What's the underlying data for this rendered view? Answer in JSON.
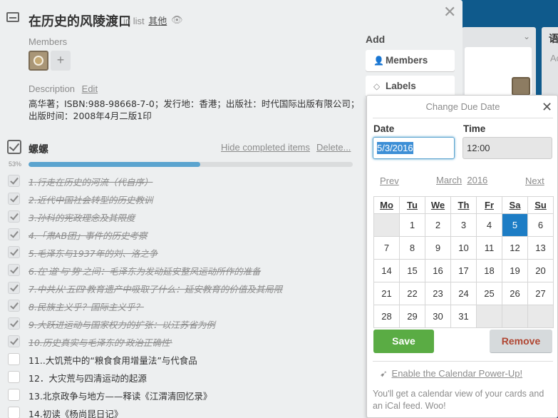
{
  "background": {
    "list_title_partial": "语",
    "list_card_partial": "Ac"
  },
  "card": {
    "title": "在历史的风陵渡口",
    "in_list_prefix": "in list",
    "list_name": "其他",
    "members_label": "Members",
    "add_member_symbol": "+",
    "description_label": "Description",
    "description_edit": "Edit",
    "description_text": "高华著；ISBN:988-98668-7-0；发行地：香港；出版社：时代国际出版有限公司；出版时间：2008年4月二版1印"
  },
  "checklist": {
    "title": "螺螺",
    "hide_completed": "Hide completed items",
    "delete": "Delete...",
    "percent_label": "53%",
    "progress_fraction": 0.53,
    "items": [
      {
        "text": "1.行走在历史的河流（代自序）",
        "done": true
      },
      {
        "text": "2.近代中国社会转型的历史教训",
        "done": true
      },
      {
        "text": "3.孙科的宪政理念及其限度",
        "done": true
      },
      {
        "text": "4.「肃AB团」事件的历史考察",
        "done": true
      },
      {
        "text": "5.毛泽东与1937年的刘、洛之争",
        "done": true
      },
      {
        "text": "6.在'道'与'势'之间：毛泽东为发动延安整风运动所作的准备",
        "done": true
      },
      {
        "text": "7.中共从'五四'教育遗产中吸取了什么：延安教育的价值及其局限",
        "done": true
      },
      {
        "text": "8.民族主义乎？国际主义乎？",
        "done": true
      },
      {
        "text": "9.大跃进运动与国家权力的扩张：以江苏省为例",
        "done": true
      },
      {
        "text": "10.历史真实与毛泽东的'政治正确性'",
        "done": true
      },
      {
        "text": "11..大饥荒中的“粮食食用增量法”与代食品",
        "done": false
      },
      {
        "text": "12．大灾荒与四清运动的起源",
        "done": false
      },
      {
        "text": "13.北京政争与地方——释读《江渭清回忆录》",
        "done": false
      },
      {
        "text": "14.初读《杨尚昆日记》",
        "done": false
      }
    ]
  },
  "sidebar": {
    "add_label": "Add",
    "buttons": [
      {
        "label": "Members",
        "icon": "person-icon"
      },
      {
        "label": "Labels",
        "icon": "tag-icon"
      }
    ]
  },
  "due_date_popover": {
    "title": "Change Due Date",
    "date_label": "Date",
    "date_value": "5/3/2016",
    "time_label": "Time",
    "time_value": "12:00",
    "prev": "Prev",
    "month": "March",
    "year": "2016",
    "next": "Next",
    "weekdays": [
      "Mo",
      "Tu",
      "We",
      "Th",
      "Fr",
      "Sa",
      "Su"
    ],
    "weeks": [
      [
        "",
        "1",
        "2",
        "3",
        "4",
        "5",
        "6"
      ],
      [
        "7",
        "8",
        "9",
        "10",
        "11",
        "12",
        "13"
      ],
      [
        "14",
        "15",
        "16",
        "17",
        "18",
        "19",
        "20"
      ],
      [
        "21",
        "22",
        "23",
        "24",
        "25",
        "26",
        "27"
      ],
      [
        "28",
        "29",
        "30",
        "31",
        "",
        "",
        ""
      ]
    ],
    "selected_day": "5",
    "save": "Save",
    "remove": "Remove",
    "powerup_link": "Enable the Calendar Power-Up!",
    "powerup_note": "You'll get a calendar view of your cards and an iCal feed. Woo!"
  },
  "colors": {
    "save_green": "#5aac44",
    "remove_red": "#b04632",
    "selected_blue": "#1d7dc5",
    "progress_blue": "#5ba4cf"
  }
}
